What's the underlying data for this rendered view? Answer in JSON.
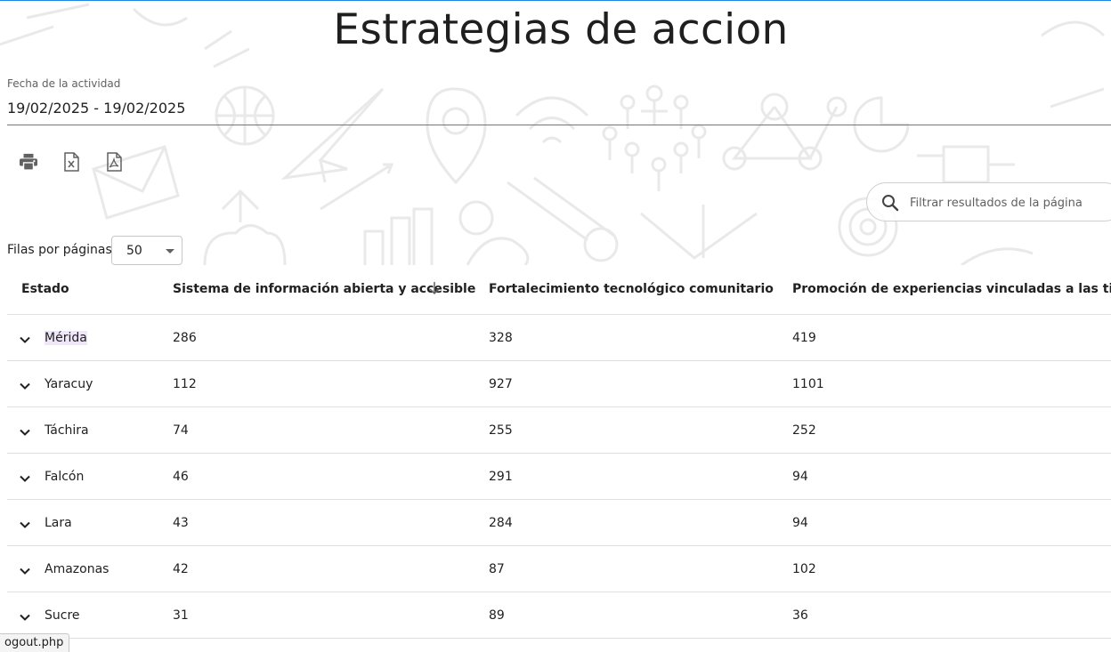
{
  "page": {
    "title": "Estrategias de accion"
  },
  "date_filter": {
    "label": "Fecha de la actividad",
    "value": "19/02/2025 - 19/02/2025"
  },
  "export": [
    {
      "icon": "print-icon"
    },
    {
      "icon": "excel-file-icon"
    },
    {
      "icon": "pdf-file-icon"
    }
  ],
  "search": {
    "placeholder": "Filtrar resultados de la página"
  },
  "pagination": {
    "rows_label": "Filas por páginas",
    "rows_value": "50"
  },
  "table": {
    "headers": [
      "Estado",
      "Sistema de información abierta y accesible",
      "Fortalecimiento tecnológico comunitario",
      "Promoción de experiencias vinculadas a las tic"
    ],
    "rows": [
      {
        "estado": "Mérida",
        "c1": "286",
        "c2": "328",
        "c3": "419"
      },
      {
        "estado": "Yaracuy",
        "c1": "112",
        "c2": "927",
        "c3": "1101"
      },
      {
        "estado": "Táchira",
        "c1": "74",
        "c2": "255",
        "c3": "252"
      },
      {
        "estado": "Falcón",
        "c1": "46",
        "c2": "291",
        "c3": "94"
      },
      {
        "estado": "Lara",
        "c1": "43",
        "c2": "284",
        "c3": "94"
      },
      {
        "estado": "Amazonas",
        "c1": "42",
        "c2": "87",
        "c3": "102"
      },
      {
        "estado": "Sucre",
        "c1": "31",
        "c2": "89",
        "c3": "36"
      }
    ]
  },
  "status_bar": {
    "url": "ogout.php"
  },
  "colors": {
    "accent_line": "#1e88e5",
    "highlight": "#efe6f7"
  }
}
